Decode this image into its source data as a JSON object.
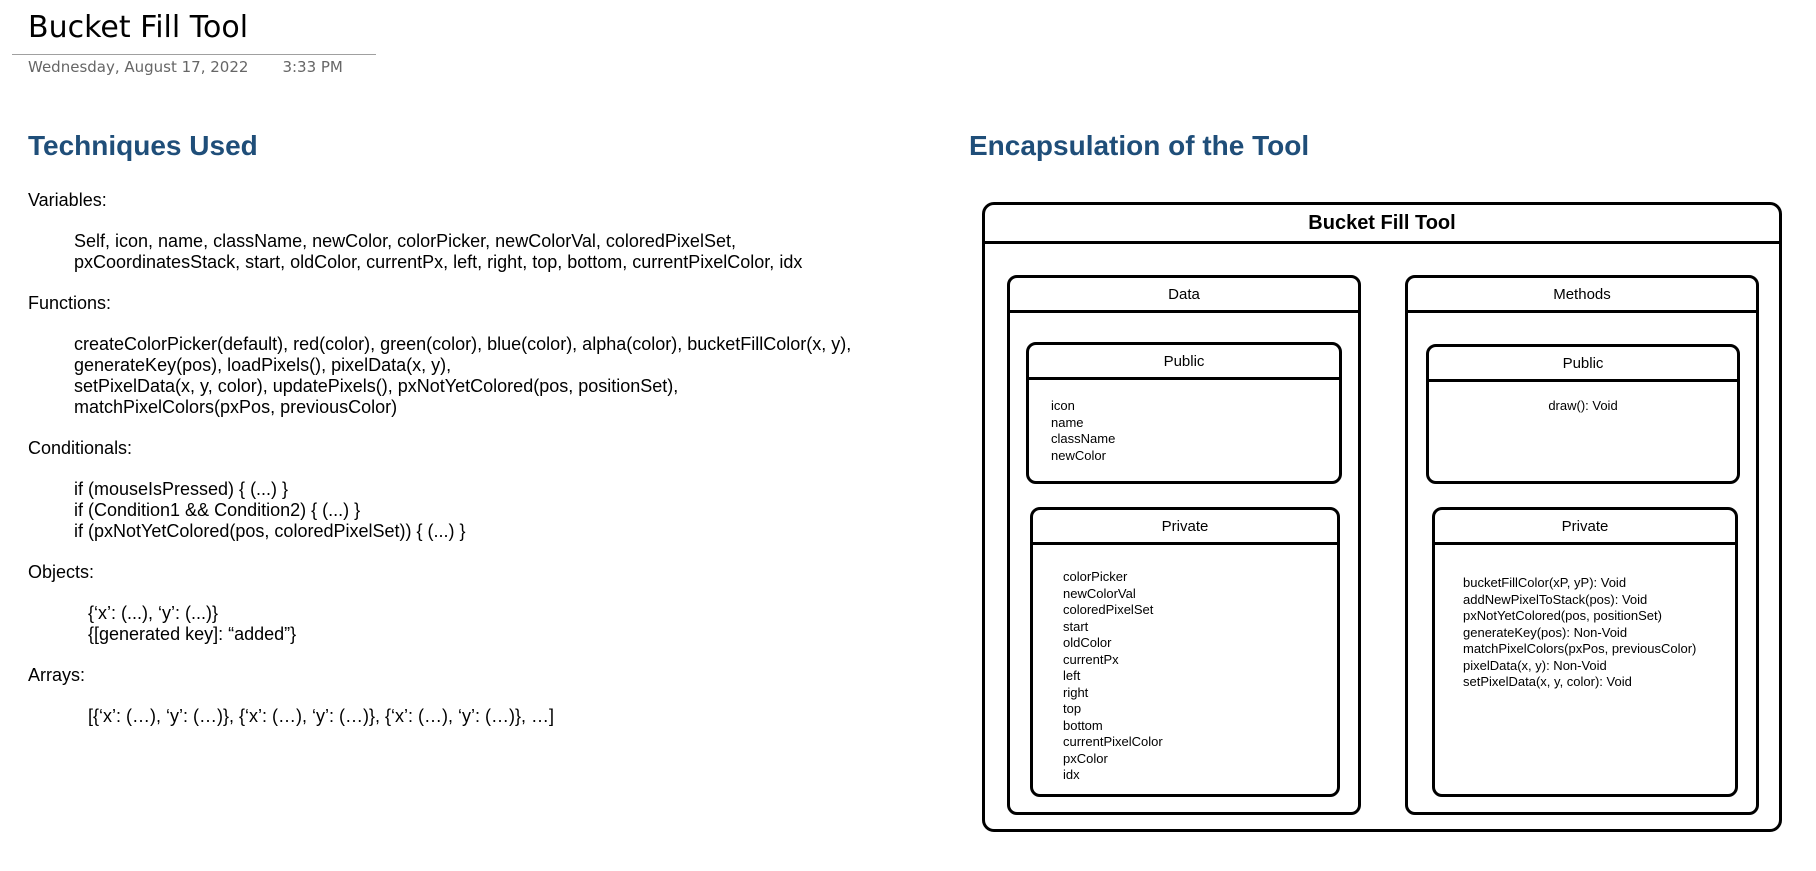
{
  "header": {
    "title": "Bucket Fill Tool",
    "date": "Wednesday, August 17, 2022",
    "time": "3:33 PM"
  },
  "left": {
    "heading": "Techniques Used",
    "variables": {
      "label": "Variables:",
      "lines": [
        "Self, icon, name, className, newColor, colorPicker, newColorVal, coloredPixelSet,",
        "pxCoordinatesStack, start, oldColor, currentPx, left, right, top, bottom, currentPixelColor, idx"
      ]
    },
    "functions": {
      "label": "Functions:",
      "lines": [
        "createColorPicker(default), red(color), green(color), blue(color), alpha(color), bucketFillColor(x, y),",
        "generateKey(pos), loadPixels(), pixelData(x, y),",
        "setPixelData(x, y, color), updatePixels(), pxNotYetColored(pos, positionSet),",
        "matchPixelColors(pxPos, previousColor)"
      ]
    },
    "conditionals": {
      "label": "Conditionals:",
      "lines": [
        "if (mouseIsPressed) {     (...)     }",
        "if (Condition1 && Condition2) {     (...)      }",
        "if (pxNotYetColored(pos, coloredPixelSet)) {     (...)      }"
      ]
    },
    "objects": {
      "label": "Objects:",
      "lines": [
        "{‘x’: (...), ‘y’: (...)}",
        "{[generated key]: “added”}"
      ]
    },
    "arrays": {
      "label": "Arrays:",
      "lines": [
        "[{‘x’: (…), ‘y’: (…)}, {‘x’: (…), ‘y’: (…)}, {‘x’: (…), ‘y’: (…)}, …]"
      ]
    }
  },
  "right": {
    "heading": "Encapsulation of the Tool",
    "diagram": {
      "title": "Bucket Fill Tool",
      "data_title": "Data",
      "methods_title": "Methods",
      "data_public": {
        "title": "Public",
        "items": [
          "icon",
          "name",
          "className",
          "newColor"
        ]
      },
      "data_private": {
        "title": "Private",
        "items": [
          "colorPicker",
          "newColorVal",
          "coloredPixelSet",
          "start",
          "oldColor",
          "currentPx",
          "left",
          "right",
          "top",
          "bottom",
          "currentPixelColor",
          "pxColor",
          "idx"
        ]
      },
      "methods_public": {
        "title": "Public",
        "items": [
          "draw(): Void"
        ]
      },
      "methods_private": {
        "title": "Private",
        "items": [
          "bucketFillColor(xP, yP): Void",
          "addNewPixelToStack(pos): Void",
          "pxNotYetColored(pos, positionSet)",
          "generateKey(pos): Non-Void",
          "matchPixelColors(pxPos, previousColor)",
          "pixelData(x, y): Non-Void",
          "setPixelData(x, y, color): Void"
        ]
      }
    }
  }
}
